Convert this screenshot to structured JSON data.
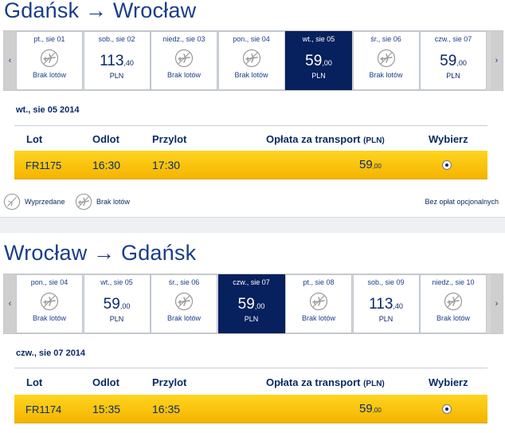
{
  "outbound": {
    "title": "Gdańsk → Wrocław",
    "nav": {
      "prev": "‹",
      "next": "›"
    },
    "days": [
      {
        "label": "pt., sie 01",
        "no_flights": true,
        "no_flights_text": "Brak lotów",
        "icon": "plane-off-icon"
      },
      {
        "label": "sob., sie 02",
        "price_main": "113",
        "price_cents": ",40",
        "currency": "PLN"
      },
      {
        "label": "niedz., sie 03",
        "no_flights": true,
        "no_flights_text": "Brak lotów",
        "icon": "plane-off-icon"
      },
      {
        "label": "pon., sie 04",
        "no_flights": true,
        "no_flights_text": "Brak lotów",
        "icon": "plane-off-icon"
      },
      {
        "label": "wt., sie 05",
        "price_main": "59",
        "price_cents": ",00",
        "currency": "PLN",
        "selected": true
      },
      {
        "label": "śr., sie 06",
        "no_flights": true,
        "no_flights_text": "Brak lotów",
        "icon": "plane-off-icon"
      },
      {
        "label": "czw., sie 07",
        "price_main": "59",
        "price_cents": ",00",
        "currency": "PLN"
      }
    ],
    "selected_date": "wt., sie 05 2014",
    "table_headers": {
      "flight": "Lot",
      "departure": "Odlot",
      "arrival": "Przylot",
      "fare": "Opłata za transport",
      "fare_unit": "(PLN)",
      "select": "Wybierz"
    },
    "flight": {
      "number": "FR1175",
      "departure": "16:30",
      "arrival": "17:30",
      "price_main": "59",
      "price_cents": ",00"
    }
  },
  "legend": {
    "sold_out": "Wyprzedane",
    "no_flights": "Brak lotów",
    "optional_fees": "Bez opłat opcjonalnych"
  },
  "return": {
    "title": "Wrocław → Gdańsk",
    "nav": {
      "prev": "‹",
      "next": "›"
    },
    "days": [
      {
        "label": "pon., sie 04",
        "no_flights": true,
        "no_flights_text": "Brak lotów",
        "icon": "plane-off-icon"
      },
      {
        "label": "wt., sie 05",
        "price_main": "59",
        "price_cents": ",00",
        "currency": "PLN"
      },
      {
        "label": "śr., sie 06",
        "no_flights": true,
        "no_flights_text": "Brak lotów",
        "icon": "plane-off-icon"
      },
      {
        "label": "czw., sie 07",
        "price_main": "59",
        "price_cents": ",00",
        "currency": "PLN",
        "selected": true
      },
      {
        "label": "pt., sie 08",
        "no_flights": true,
        "no_flights_text": "Brak lotów",
        "icon": "plane-off-icon"
      },
      {
        "label": "sob., sie 09",
        "price_main": "113",
        "price_cents": ",40",
        "currency": "PLN"
      },
      {
        "label": "niedz., sie 10",
        "no_flights": true,
        "no_flights_text": "Brak lotów",
        "icon": "plane-off-icon"
      }
    ],
    "selected_date": "czw., sie 07 2014",
    "table_headers": {
      "flight": "Lot",
      "departure": "Odlot",
      "arrival": "Przylot",
      "fare": "Opłata za transport",
      "fare_unit": "(PLN)",
      "select": "Wybierz"
    },
    "flight": {
      "number": "FR1174",
      "departure": "15:35",
      "arrival": "16:35",
      "price_main": "59",
      "price_cents": ",00"
    }
  },
  "colors": {
    "selected_day": "#07205e",
    "flight_row": "#ffd41f",
    "text": "#0a2a66"
  }
}
